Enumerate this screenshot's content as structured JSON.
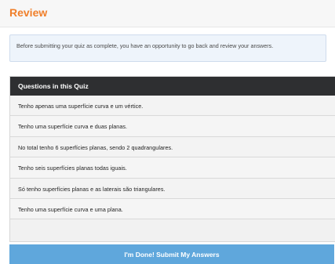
{
  "header": {
    "title": "Review"
  },
  "info": {
    "text": "Before submitting your quiz as complete, you have an opportunity to go back and review your answers."
  },
  "questions_panel": {
    "title": "Questions in this Quiz",
    "items": [
      {
        "label": "Tenho apenas uma superfície curva e um vértice."
      },
      {
        "label": "Tenho uma superfície curva e duas planas."
      },
      {
        "label": "No total tenho 6 superfícies planas, sendo 2 quadrangulares."
      },
      {
        "label": "Tenho seis superfícies planas todas iguais."
      },
      {
        "label": "Só tenho superfícies planas e as laterais são triangulares."
      },
      {
        "label": "Tenho uma superfície curva e uma plana."
      }
    ]
  },
  "submit": {
    "label": "I'm Done! Submit My Answers"
  },
  "colors": {
    "title_orange": "#f07f2a",
    "panel_header": "#2e2f31",
    "submit_blue": "#5fa7dc",
    "info_bg": "#eef4fb"
  }
}
